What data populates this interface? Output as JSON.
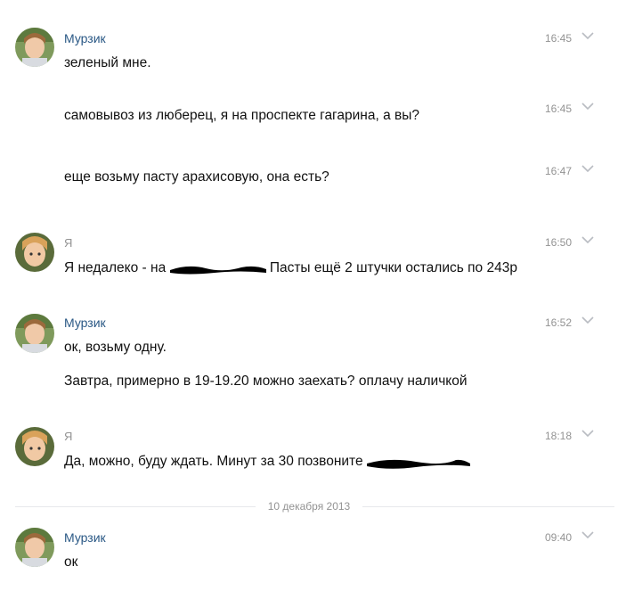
{
  "messages": [
    {
      "author": "Мурзик",
      "time": "16:45",
      "text": "зеленый мне."
    },
    {
      "time": "16:45",
      "text": "самовывоз из люберец, я на проспекте гагарина, а вы?"
    },
    {
      "time": "16:47",
      "text": "еще возьму пасту арахисовую, она есть?"
    },
    {
      "author": "Я",
      "time": "16:50",
      "text_before": "Я недалеко - на ",
      "text_after": " Пасты ещё 2 штучки остались по 243р"
    },
    {
      "author": "Мурзик",
      "time": "16:52",
      "text": "ок, возьму одну.",
      "text2": "Завтра, примерно в 19-19.20 можно заехать? оплачу наличкой"
    },
    {
      "author": "Я",
      "time": "18:18",
      "text_before": "Да, можно, буду ждать. Минут за 30 позвоните "
    },
    {
      "author": "Мурзик",
      "time": "09:40",
      "text": "ок"
    }
  ],
  "date_divider": "10 декабря 2013",
  "colors": {
    "author_link": "#2a5885",
    "muted": "#939393",
    "divider": "#e7e8ec"
  }
}
